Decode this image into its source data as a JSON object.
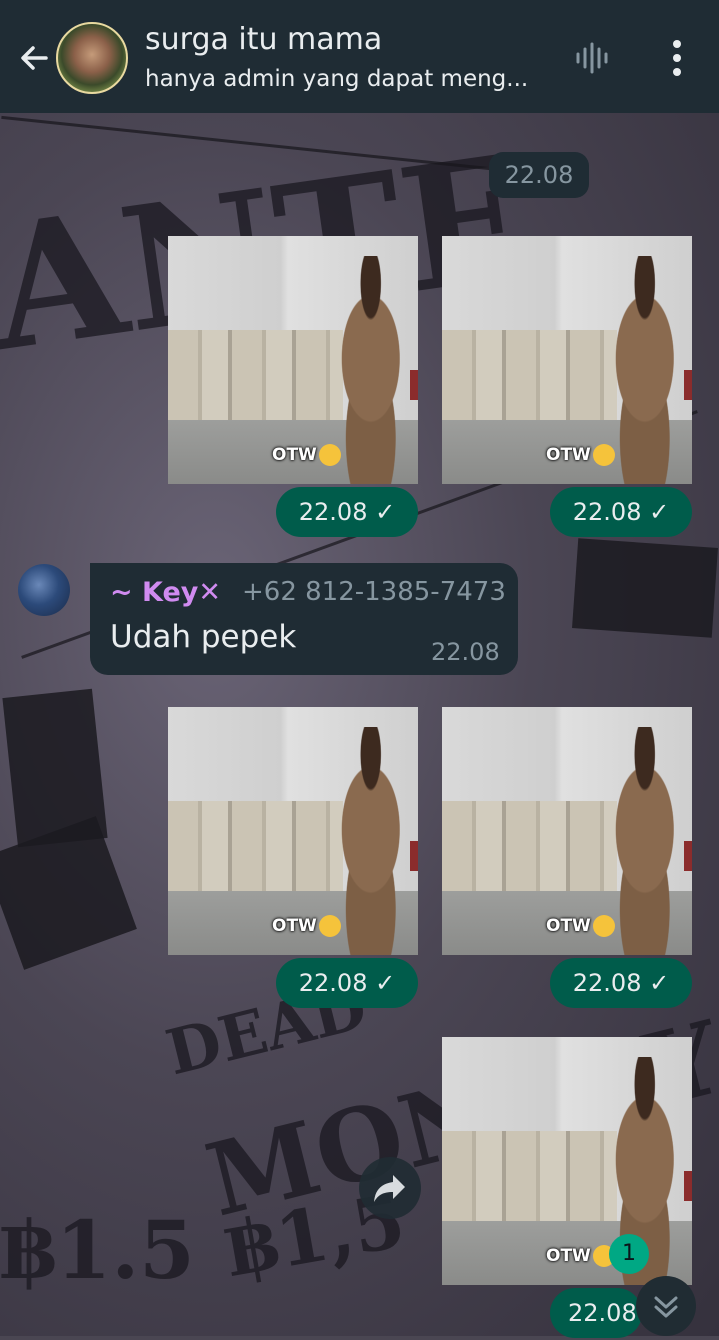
{
  "header": {
    "title": "surga itu mama",
    "subtitle": "hanya admin yang dapat meng..."
  },
  "messages": {
    "date_pill": "22.08",
    "photo_caption": "OTW",
    "outgoing_time": "22.08",
    "incoming": {
      "sender_name": "~ Key✕",
      "sender_phone": "+62 812-1385-7473",
      "text": "Udah pepek",
      "time": "22.08"
    },
    "last_time": "22.08"
  },
  "unread_badge": "1",
  "wallpaper": {
    "texts": [
      "DEAD",
      "MONKEY.D.",
      "฿1.5",
      "฿1,5",
      "ANTE"
    ]
  },
  "colors": {
    "header_bg": "#1f2c34",
    "outgoing_bubble": "#005c4b",
    "incoming_bubble": "#1f2c34",
    "sender_name": "#d08bf0",
    "badge": "#00a884"
  }
}
